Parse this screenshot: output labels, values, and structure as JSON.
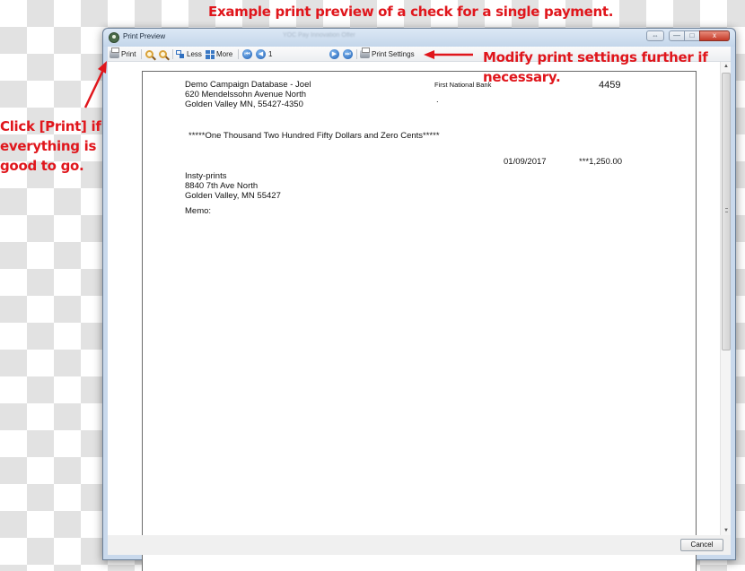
{
  "annotations": {
    "top": "Example print preview of a check for a single payment.",
    "right": "Modify print settings further if necessary.",
    "left": "Click [Print] if everything is good to go."
  },
  "window": {
    "title": "Print Preview",
    "title_center_blurred": "YOC Pay Innovation Offer",
    "buttons": {
      "resize": "⇔",
      "minimize": "—",
      "maximize": "□",
      "close": "x"
    }
  },
  "toolbar": {
    "print_label": "Print",
    "zoom_in_icon": "zoom-in-icon",
    "zoom_out_icon": "zoom-out-icon",
    "less_label": "Less",
    "more_label": "More",
    "first_icon": "⏮",
    "prev_icon": "◀",
    "page_value": "1",
    "next_icon": "▶",
    "last_icon": "⏭",
    "print_settings_label": "Print Settings"
  },
  "check": {
    "payer_name": "Demo Campaign Database - Joel",
    "payer_address1": "620 Mendelssohn Avenue North",
    "payer_address2": "Golden Valley MN, 55427-4350",
    "bank_name": "First National Bank",
    "bank_dot": ".",
    "check_number": "4459",
    "amount_words": "*****One Thousand Two Hundred Fifty Dollars and Zero Cents*****",
    "date": "01/09/2017",
    "amount": "***1,250.00",
    "payee_name": "Insty-prints",
    "payee_address1": "8840 7th Ave North",
    "payee_address2": "Golden Valley, MN 55427",
    "memo_label": "Memo:"
  },
  "footer": {
    "cancel_label": "Cancel"
  },
  "colors": {
    "annotation": "#e0161c",
    "nav_button": "#1e5fb4",
    "close_button": "#c43a28"
  }
}
